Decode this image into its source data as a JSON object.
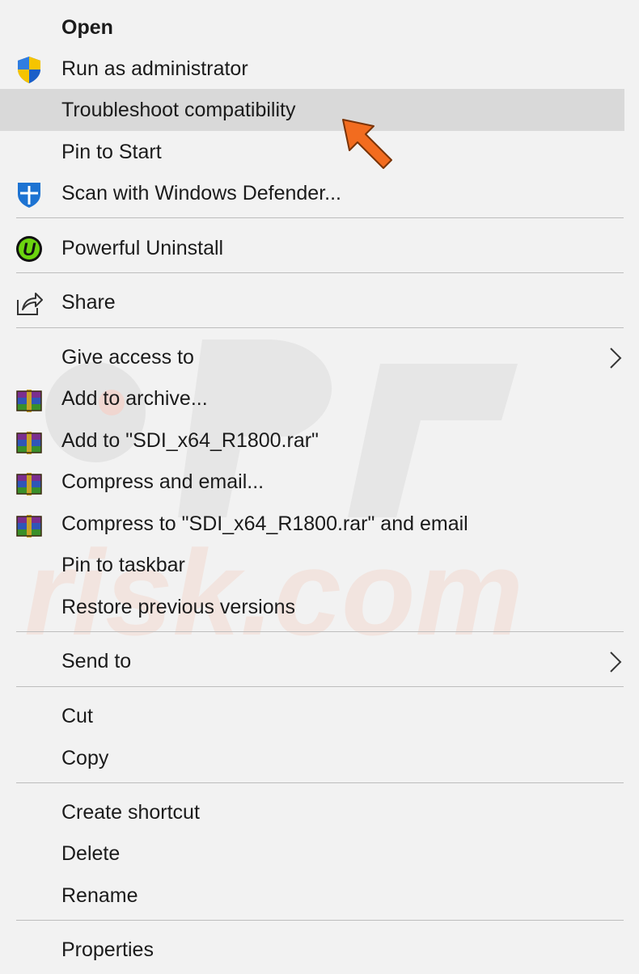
{
  "menu": {
    "items": {
      "open": {
        "label": "Open"
      },
      "run_admin": {
        "label": "Run as administrator",
        "icon": "uac-shield-icon"
      },
      "troubleshoot": {
        "label": "Troubleshoot compatibility"
      },
      "pin_start": {
        "label": "Pin to Start"
      },
      "scan_defender": {
        "label": "Scan with Windows Defender...",
        "icon": "windows-defender-icon"
      },
      "powerful_uninstall": {
        "label": "Powerful Uninstall",
        "icon": "iobit-uninstaller-icon"
      },
      "share": {
        "label": "Share",
        "icon": "share-icon"
      },
      "give_access": {
        "label": "Give access to"
      },
      "add_archive": {
        "label": "Add to archive...",
        "icon": "winrar-icon"
      },
      "add_to_rar": {
        "label": "Add to \"SDI_x64_R1800.rar\"",
        "icon": "winrar-icon"
      },
      "compress_email": {
        "label": "Compress and email...",
        "icon": "winrar-icon"
      },
      "compress_rar_email": {
        "label": "Compress to \"SDI_x64_R1800.rar\" and email",
        "icon": "winrar-icon"
      },
      "pin_taskbar": {
        "label": "Pin to taskbar"
      },
      "restore_versions": {
        "label": "Restore previous versions"
      },
      "send_to": {
        "label": "Send to"
      },
      "cut": {
        "label": "Cut"
      },
      "copy": {
        "label": "Copy"
      },
      "create_shortcut": {
        "label": "Create shortcut"
      },
      "delete": {
        "label": "Delete"
      },
      "rename": {
        "label": "Rename"
      },
      "properties": {
        "label": "Properties"
      }
    },
    "highlighted_item": "troubleshoot",
    "colors": {
      "background": "#f2f2f2",
      "highlight": "#d9d9d9",
      "separator": "#bdbdbd",
      "text": "#1b1b1b",
      "pointer_arrow": "#f26c1f"
    }
  },
  "watermark": {
    "text": "risk.com"
  }
}
